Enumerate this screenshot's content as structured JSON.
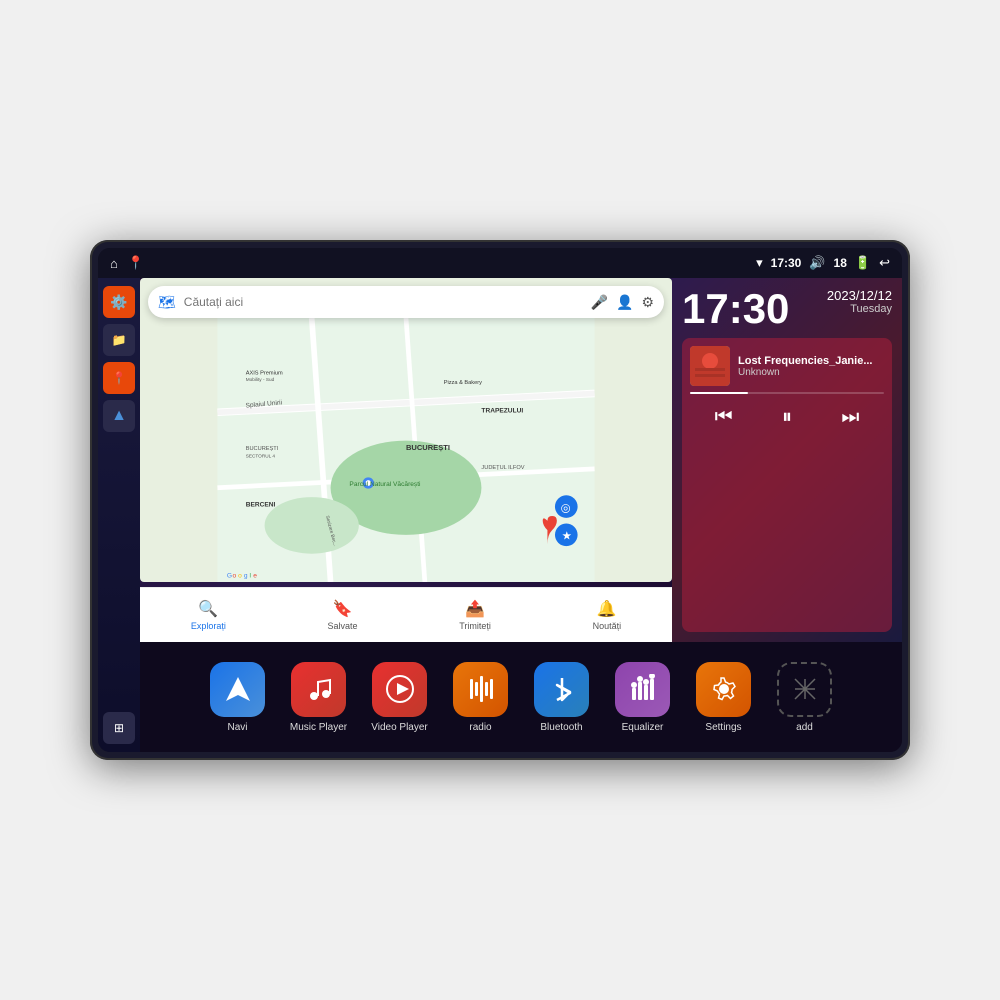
{
  "device": {
    "status_bar": {
      "left_icons": [
        "home",
        "location"
      ],
      "wifi_icon": "wifi",
      "time": "17:30",
      "volume_icon": "volume",
      "battery_level": "18",
      "battery_icon": "battery",
      "back_icon": "back"
    },
    "sidebar": {
      "buttons": [
        {
          "name": "settings",
          "icon": "⚙️",
          "style": "orange"
        },
        {
          "name": "files",
          "icon": "📁",
          "style": "dark"
        },
        {
          "name": "map",
          "icon": "📍",
          "style": "orange"
        },
        {
          "name": "navigation",
          "icon": "▲",
          "style": "dark"
        }
      ],
      "grid_button": "⊞"
    },
    "map": {
      "search_placeholder": "Căutați aici",
      "bottom_items": [
        {
          "label": "Explorați",
          "icon": "🔍",
          "active": true
        },
        {
          "label": "Salvate",
          "icon": "🔖",
          "active": false
        },
        {
          "label": "Trimiteți",
          "icon": "📤",
          "active": false
        },
        {
          "label": "Noutăți",
          "icon": "🔔",
          "active": false
        }
      ]
    },
    "clock": {
      "time": "17:30",
      "date": "2023/12/12",
      "day": "Tuesday"
    },
    "music": {
      "title": "Lost Frequencies_Janie...",
      "artist": "Unknown",
      "album_art": "🎵",
      "progress": 30
    },
    "apps": [
      {
        "name": "Navi",
        "label": "Navi",
        "icon": "▲",
        "style": "navi"
      },
      {
        "name": "Music Player",
        "label": "Music Player",
        "icon": "🎵",
        "style": "music"
      },
      {
        "name": "Video Player",
        "label": "Video Player",
        "icon": "▶",
        "style": "video"
      },
      {
        "name": "radio",
        "label": "radio",
        "icon": "📻",
        "style": "radio"
      },
      {
        "name": "Bluetooth",
        "label": "Bluetooth",
        "icon": "⬡",
        "style": "bluetooth"
      },
      {
        "name": "Equalizer",
        "label": "Equalizer",
        "icon": "🎛",
        "style": "equalizer"
      },
      {
        "name": "Settings",
        "label": "Settings",
        "icon": "⚙",
        "style": "settings"
      },
      {
        "name": "add",
        "label": "add",
        "icon": "+",
        "style": "add"
      }
    ]
  }
}
